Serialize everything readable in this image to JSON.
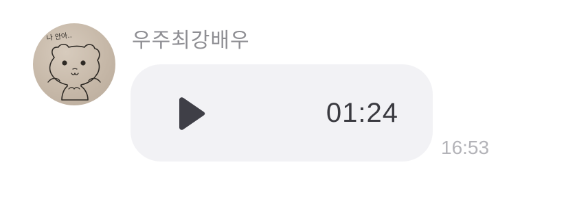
{
  "message": {
    "sender_name": "우주최강배우",
    "avatar_icon": "bear-drawing-avatar",
    "avatar_caption": "나 안아..",
    "voice": {
      "play_icon": "play-icon",
      "duration": "01:24"
    },
    "time": "16:53"
  },
  "colors": {
    "bubble": "#f2f2f5",
    "sender_name": "#8e8e93",
    "duration": "#3a3a40",
    "timestamp": "#b3b3b8",
    "play_icon": "#3f3f47"
  }
}
